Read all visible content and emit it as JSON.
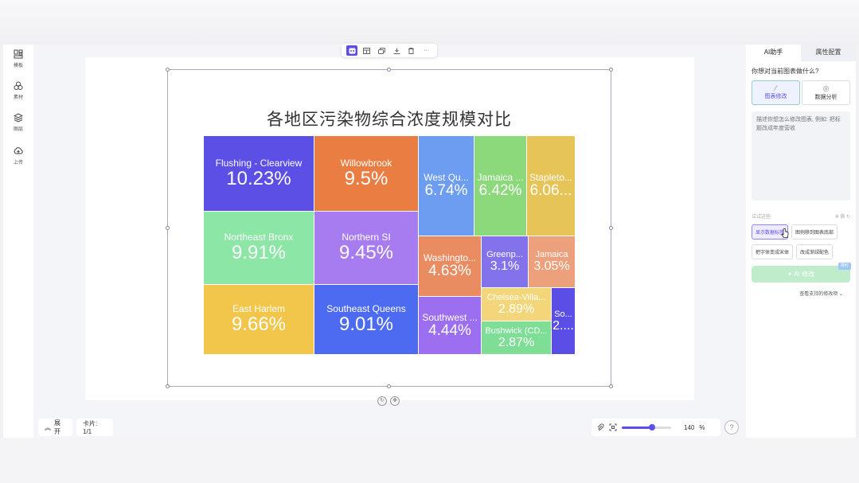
{
  "left_sidebar": {
    "items": [
      {
        "label": "模板",
        "icon": "template-icon"
      },
      {
        "label": "素材",
        "icon": "assets-icon"
      },
      {
        "label": "图层",
        "icon": "layers-icon"
      },
      {
        "label": "上传",
        "icon": "upload-icon"
      }
    ]
  },
  "chart_toolbar": {
    "buttons": [
      "ai-edit-icon",
      "layout-icon",
      "copy-icon",
      "download-icon",
      "delete-icon",
      "more-icon"
    ],
    "more_label": "···"
  },
  "chart_data": {
    "type": "treemap",
    "title": "各地区污染物综合浓度规模对比",
    "unit": "%",
    "items": [
      {
        "name": "Flushing - Clearview",
        "label": "Flushing - Clearview",
        "value": 10.23,
        "value_label": "10.23%",
        "color": "#5b4fe5"
      },
      {
        "name": "Willowbrook",
        "label": "Willowbrook",
        "value": 9.5,
        "value_label": "9.5%",
        "color": "#ea7d41"
      },
      {
        "name": "West Queens",
        "label": "West Qu...",
        "value": 6.74,
        "value_label": "6.74%",
        "color": "#6c9df0"
      },
      {
        "name": "Jamaica",
        "label": "Jamaica ...",
        "value": 6.42,
        "value_label": "6.42%",
        "color": "#8cd97b"
      },
      {
        "name": "Stapleton",
        "label": "Stapleto...",
        "value": 6.06,
        "value_label": "6.06...",
        "color": "#e6c458"
      },
      {
        "name": "Northeast Bronx",
        "label": "Northeast Bronx",
        "value": 9.91,
        "value_label": "9.91%",
        "color": "#8ce6a6"
      },
      {
        "name": "Northern SI",
        "label": "Northern SI",
        "value": 9.45,
        "value_label": "9.45%",
        "color": "#a77cf0"
      },
      {
        "name": "Washington Heights",
        "label": "Washingto...",
        "value": 4.63,
        "value_label": "4.63%",
        "color": "#ea8c62"
      },
      {
        "name": "Greenpoint",
        "label": "Greenp...",
        "value": 3.1,
        "value_label": "3.1%",
        "color": "#8273ec"
      },
      {
        "name": "Jamaica",
        "label": "Jamaica",
        "value": 3.05,
        "value_label": "3.05%",
        "color": "#eda07c"
      },
      {
        "name": "East Harlem",
        "label": "East Harlem",
        "value": 9.66,
        "value_label": "9.66%",
        "color": "#f1c64a"
      },
      {
        "name": "Southeast Queens",
        "label": "Southeast Queens",
        "value": 9.01,
        "value_label": "9.01%",
        "color": "#4d6bf0"
      },
      {
        "name": "Southwest",
        "label": "Southwest ...",
        "value": 4.44,
        "value_label": "4.44%",
        "color": "#9c6ff0"
      },
      {
        "name": "Chelsea-Village",
        "label": "Chelsea-Villa...",
        "value": 2.89,
        "value_label": "2.89%",
        "color": "#f3d57a"
      },
      {
        "name": "Bushwick",
        "label": "Bushwick (CD...",
        "value": 2.87,
        "value_label": "2.87%",
        "color": "#7ede95"
      },
      {
        "name": "South",
        "label": "So...",
        "value": null,
        "value_label": "2....",
        "color": "#5a4ee6"
      }
    ]
  },
  "bottom_bar": {
    "expand_label": "展开",
    "expand_icon": "chevrons-up-icon",
    "card_label": "卡片: 1/1",
    "zoom_value": "140",
    "zoom_unit": "%",
    "zoom_fraction": 0.62,
    "help_label": "?"
  },
  "right_panel": {
    "tabs": [
      {
        "label": "AI助手",
        "active": true
      },
      {
        "label": "属性配置",
        "active": false
      }
    ],
    "question": "你想对当前图表做什么?",
    "modes": [
      {
        "label": "图表修改",
        "icon": "wand-icon",
        "active": true
      },
      {
        "label": "数据分析",
        "icon": "analysis-icon",
        "active": false
      }
    ],
    "prompt_placeholder": "描述你想怎么修改图表, 例如: 把标题改成年度营收",
    "try_label": "试试这些:",
    "refresh_label": "换",
    "suggestions_row1": [
      "显示数据标签",
      "图例移到图表底部"
    ],
    "suggestions_row2": [
      "把字体变成宋体",
      "改成渐绿配色"
    ],
    "ai_button_label": "AI 修改",
    "ai_badge": "限时",
    "support_label": "查看支持的修改项"
  }
}
